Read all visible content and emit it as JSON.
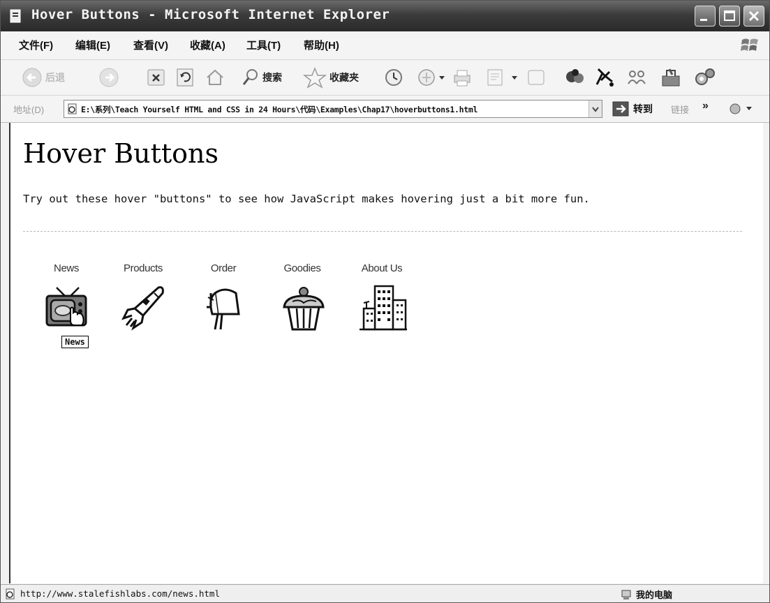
{
  "window": {
    "title": "Hover Buttons - Microsoft Internet Explorer"
  },
  "menu": {
    "items": [
      {
        "label": "文件(F)"
      },
      {
        "label": "编辑(E)"
      },
      {
        "label": "查看(V)"
      },
      {
        "label": "收藏(A)"
      },
      {
        "label": "工具(T)"
      },
      {
        "label": "帮助(H)"
      }
    ]
  },
  "toolbar": {
    "back_label": "后退",
    "search_label": "搜索",
    "favorites_label": "收藏夹"
  },
  "address": {
    "label": "地址(D)",
    "url": "E:\\系列\\Teach Yourself HTML and CSS in 24 Hours\\代码\\Examples\\Chap17\\hoverbuttons1.html",
    "go_label": "转到",
    "links_label": "链接",
    "chevron": "»"
  },
  "page": {
    "title": "Hover Buttons",
    "intro": "Try out these hover \"buttons\" to see how JavaScript makes hovering just a bit more fun.",
    "buttons": [
      {
        "label": "News",
        "icon": "tv-icon"
      },
      {
        "label": "Products",
        "icon": "rocket-icon"
      },
      {
        "label": "Order",
        "icon": "mailbox-icon"
      },
      {
        "label": "Goodies",
        "icon": "cupcake-icon"
      },
      {
        "label": "About Us",
        "icon": "building-icon"
      }
    ],
    "tooltip": "News"
  },
  "status": {
    "url": "http://www.stalefishlabs.com/news.html",
    "zone": "我的电脑"
  },
  "colors": {
    "titlebar": "#3c3c3c",
    "chrome": "#f4f4f4",
    "content_bg": "#ffffff"
  }
}
